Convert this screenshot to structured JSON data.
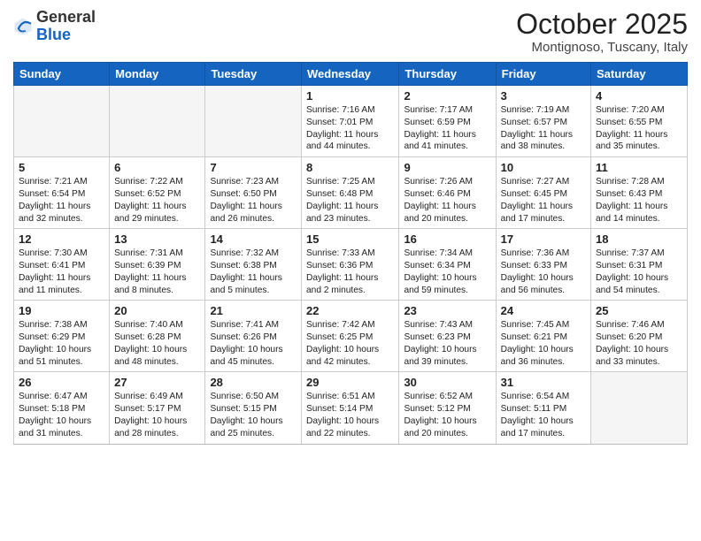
{
  "header": {
    "logo_general": "General",
    "logo_blue": "Blue",
    "month_title": "October 2025",
    "location": "Montignoso, Tuscany, Italy"
  },
  "days_of_week": [
    "Sunday",
    "Monday",
    "Tuesday",
    "Wednesday",
    "Thursday",
    "Friday",
    "Saturday"
  ],
  "weeks": [
    [
      {
        "day": "",
        "info": "",
        "empty": true
      },
      {
        "day": "",
        "info": "",
        "empty": true
      },
      {
        "day": "",
        "info": "",
        "empty": true
      },
      {
        "day": "1",
        "info": "Sunrise: 7:16 AM\nSunset: 7:01 PM\nDaylight: 11 hours and 44 minutes."
      },
      {
        "day": "2",
        "info": "Sunrise: 7:17 AM\nSunset: 6:59 PM\nDaylight: 11 hours and 41 minutes."
      },
      {
        "day": "3",
        "info": "Sunrise: 7:19 AM\nSunset: 6:57 PM\nDaylight: 11 hours and 38 minutes."
      },
      {
        "day": "4",
        "info": "Sunrise: 7:20 AM\nSunset: 6:55 PM\nDaylight: 11 hours and 35 minutes."
      }
    ],
    [
      {
        "day": "5",
        "info": "Sunrise: 7:21 AM\nSunset: 6:54 PM\nDaylight: 11 hours and 32 minutes."
      },
      {
        "day": "6",
        "info": "Sunrise: 7:22 AM\nSunset: 6:52 PM\nDaylight: 11 hours and 29 minutes."
      },
      {
        "day": "7",
        "info": "Sunrise: 7:23 AM\nSunset: 6:50 PM\nDaylight: 11 hours and 26 minutes."
      },
      {
        "day": "8",
        "info": "Sunrise: 7:25 AM\nSunset: 6:48 PM\nDaylight: 11 hours and 23 minutes."
      },
      {
        "day": "9",
        "info": "Sunrise: 7:26 AM\nSunset: 6:46 PM\nDaylight: 11 hours and 20 minutes."
      },
      {
        "day": "10",
        "info": "Sunrise: 7:27 AM\nSunset: 6:45 PM\nDaylight: 11 hours and 17 minutes."
      },
      {
        "day": "11",
        "info": "Sunrise: 7:28 AM\nSunset: 6:43 PM\nDaylight: 11 hours and 14 minutes."
      }
    ],
    [
      {
        "day": "12",
        "info": "Sunrise: 7:30 AM\nSunset: 6:41 PM\nDaylight: 11 hours and 11 minutes."
      },
      {
        "day": "13",
        "info": "Sunrise: 7:31 AM\nSunset: 6:39 PM\nDaylight: 11 hours and 8 minutes."
      },
      {
        "day": "14",
        "info": "Sunrise: 7:32 AM\nSunset: 6:38 PM\nDaylight: 11 hours and 5 minutes."
      },
      {
        "day": "15",
        "info": "Sunrise: 7:33 AM\nSunset: 6:36 PM\nDaylight: 11 hours and 2 minutes."
      },
      {
        "day": "16",
        "info": "Sunrise: 7:34 AM\nSunset: 6:34 PM\nDaylight: 10 hours and 59 minutes."
      },
      {
        "day": "17",
        "info": "Sunrise: 7:36 AM\nSunset: 6:33 PM\nDaylight: 10 hours and 56 minutes."
      },
      {
        "day": "18",
        "info": "Sunrise: 7:37 AM\nSunset: 6:31 PM\nDaylight: 10 hours and 54 minutes."
      }
    ],
    [
      {
        "day": "19",
        "info": "Sunrise: 7:38 AM\nSunset: 6:29 PM\nDaylight: 10 hours and 51 minutes."
      },
      {
        "day": "20",
        "info": "Sunrise: 7:40 AM\nSunset: 6:28 PM\nDaylight: 10 hours and 48 minutes."
      },
      {
        "day": "21",
        "info": "Sunrise: 7:41 AM\nSunset: 6:26 PM\nDaylight: 10 hours and 45 minutes."
      },
      {
        "day": "22",
        "info": "Sunrise: 7:42 AM\nSunset: 6:25 PM\nDaylight: 10 hours and 42 minutes."
      },
      {
        "day": "23",
        "info": "Sunrise: 7:43 AM\nSunset: 6:23 PM\nDaylight: 10 hours and 39 minutes."
      },
      {
        "day": "24",
        "info": "Sunrise: 7:45 AM\nSunset: 6:21 PM\nDaylight: 10 hours and 36 minutes."
      },
      {
        "day": "25",
        "info": "Sunrise: 7:46 AM\nSunset: 6:20 PM\nDaylight: 10 hours and 33 minutes."
      }
    ],
    [
      {
        "day": "26",
        "info": "Sunrise: 6:47 AM\nSunset: 5:18 PM\nDaylight: 10 hours and 31 minutes."
      },
      {
        "day": "27",
        "info": "Sunrise: 6:49 AM\nSunset: 5:17 PM\nDaylight: 10 hours and 28 minutes."
      },
      {
        "day": "28",
        "info": "Sunrise: 6:50 AM\nSunset: 5:15 PM\nDaylight: 10 hours and 25 minutes."
      },
      {
        "day": "29",
        "info": "Sunrise: 6:51 AM\nSunset: 5:14 PM\nDaylight: 10 hours and 22 minutes."
      },
      {
        "day": "30",
        "info": "Sunrise: 6:52 AM\nSunset: 5:12 PM\nDaylight: 10 hours and 20 minutes."
      },
      {
        "day": "31",
        "info": "Sunrise: 6:54 AM\nSunset: 5:11 PM\nDaylight: 10 hours and 17 minutes."
      },
      {
        "day": "",
        "info": "",
        "empty": true
      }
    ]
  ]
}
